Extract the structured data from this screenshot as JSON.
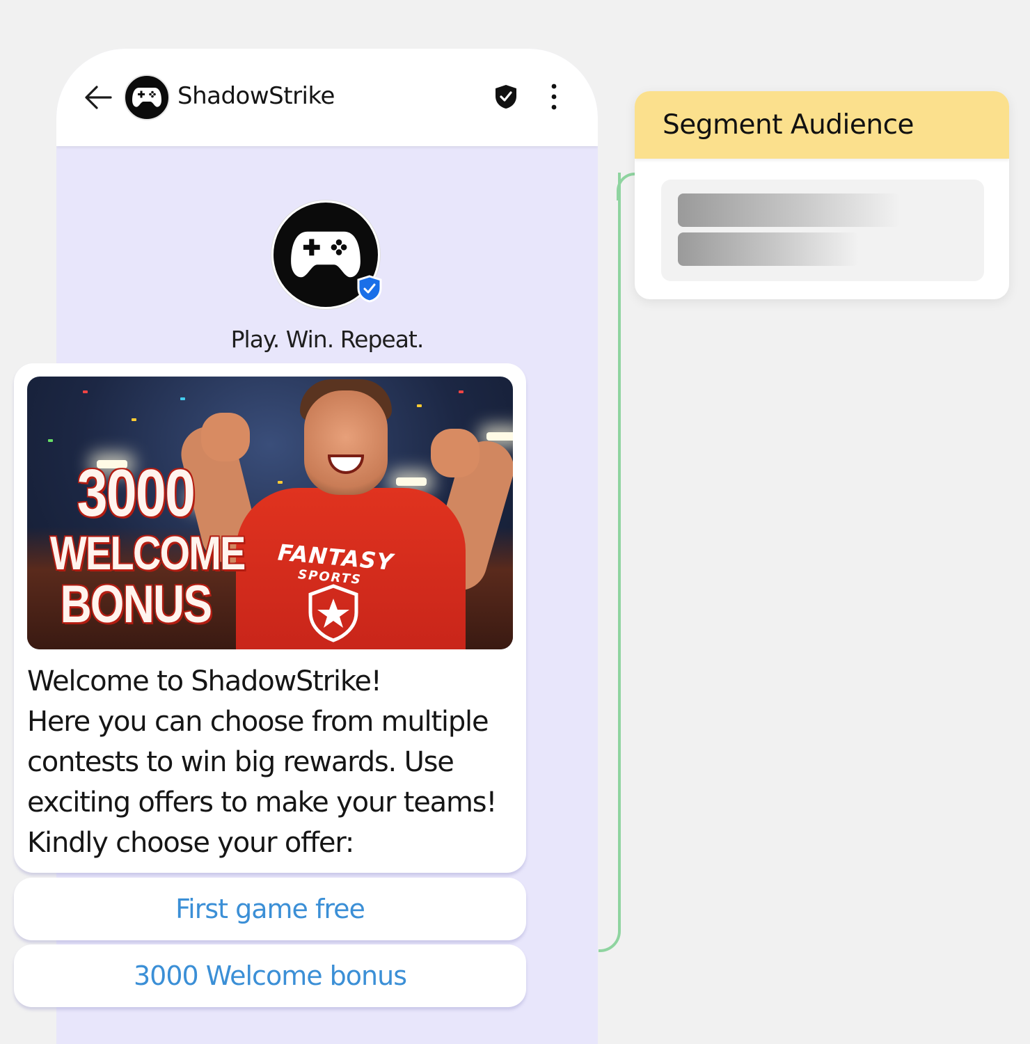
{
  "chat_header": {
    "title": "ShadowStrike"
  },
  "profile": {
    "tagline": "Play. Win. Repeat."
  },
  "promo_image": {
    "amount": "3000",
    "line1": "WELCOME",
    "line2": "BONUS",
    "shirt_text_1": "FANTASY",
    "shirt_text_2": "SPORTS"
  },
  "message": {
    "lines": [
      "Welcome to ShadowStrike!",
      "Here you can choose from multiple",
      "contests to win big rewards. Use",
      "exciting offers to make your teams!",
      "Kindly choose your offer:"
    ]
  },
  "quick_replies": [
    {
      "label": "First game free"
    },
    {
      "label": "3000 Welcome bonus"
    }
  ],
  "segment_card": {
    "title": "Segment Audience"
  },
  "colors": {
    "chat_background": "#e8e6fb",
    "reply_text": "#3b8fd6",
    "segment_header": "#fbe08d",
    "connector": "#8fd4a0",
    "verified_badge": "#1a6fe8"
  }
}
